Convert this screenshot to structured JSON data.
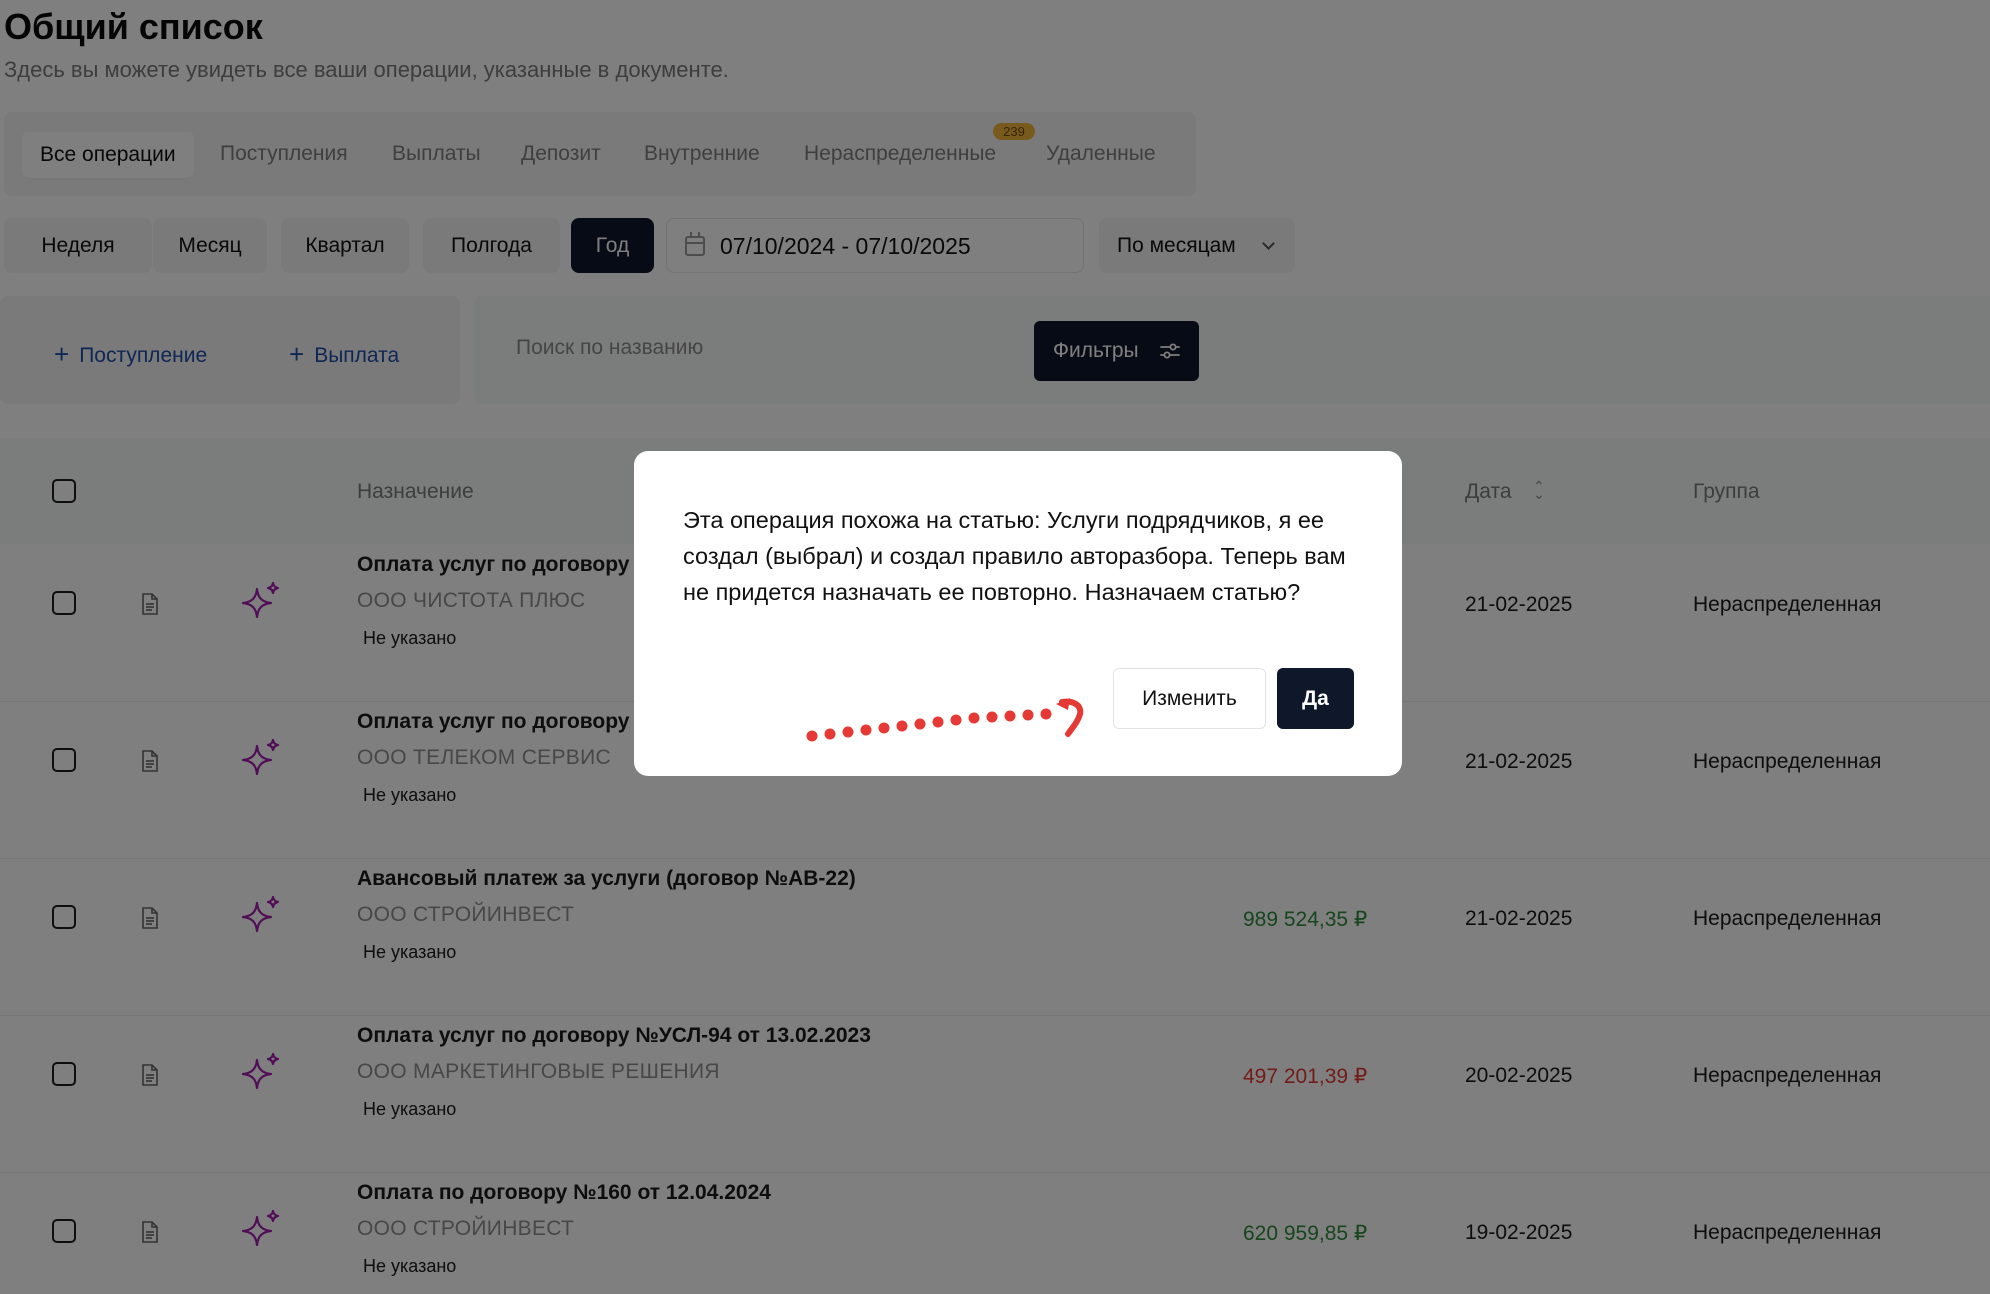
{
  "page": {
    "title": "Общий список",
    "subtitle": "Здесь вы можете увидеть все ваши операции, указанные в документе."
  },
  "tabs": [
    {
      "label": "Все операции",
      "active": true
    },
    {
      "label": "Поступления"
    },
    {
      "label": "Выплаты"
    },
    {
      "label": "Депозит"
    },
    {
      "label": "Внутренние"
    },
    {
      "label": "Нераспределенные",
      "badge": "239"
    },
    {
      "label": "Удаленные"
    }
  ],
  "periods": [
    {
      "label": "Неделя"
    },
    {
      "label": "Месяц"
    },
    {
      "label": "Квартал"
    },
    {
      "label": "Полгода"
    },
    {
      "label": "Год",
      "active": true
    }
  ],
  "date_range": "07/10/2024 - 07/10/2025",
  "grouping": "По месяцам",
  "actions": {
    "add_income": "Поступление",
    "add_payout": "Выплата",
    "search_placeholder": "Поиск по названию",
    "filters": "Фильтры"
  },
  "table": {
    "headers": {
      "purpose": "Назначение",
      "date": "Дата",
      "group": "Группа"
    },
    "rows": [
      {
        "title": "Оплата услуг по договору",
        "counterparty": "ООО ЧИСТОТА ПЛЮС",
        "note": "Не указано",
        "amount": "",
        "amount_color": "",
        "date": "21-02-2025",
        "group": "Нераспределенная"
      },
      {
        "title": "Оплата услуг по договору",
        "counterparty": "ООО ТЕЛЕКОМ СЕРВИС",
        "note": "Не указано",
        "amount": "",
        "amount_color": "",
        "date": "21-02-2025",
        "group": "Нераспределенная"
      },
      {
        "title": "Авансовый платеж за услуги (договор №АВ-22)",
        "counterparty": "ООО СТРОЙИНВЕСТ",
        "note": "Не указано",
        "amount": "989 524,35 ₽",
        "amount_color": "#2e8b3a",
        "date": "21-02-2025",
        "group": "Нераспределенная"
      },
      {
        "title": "Оплата услуг по договору №УСЛ-94 от 13.02.2023",
        "counterparty": "ООО МАРКЕТИНГОВЫЕ РЕШЕНИЯ",
        "note": "Не указано",
        "amount": "497 201,39 ₽",
        "amount_color": "#e53935",
        "date": "20-02-2025",
        "group": "Нераспределенная"
      },
      {
        "title": "Оплата по договору №160 от 12.04.2024",
        "counterparty": "ООО СТРОЙИНВЕСТ",
        "note": "Не указано",
        "amount": "620 959,85 ₽",
        "amount_color": "#2e8b3a",
        "date": "19-02-2025",
        "group": "Нераспределенная"
      }
    ]
  },
  "modal": {
    "text": "Эта операция похожа на статью: Услуги подрядчиков, я ее создал (выбрал) и создал правило авторазбора. Теперь вам не придется назначать ее повторно. Назначаем статью?",
    "change_label": "Изменить",
    "yes_label": "Да"
  },
  "colors": {
    "primary_dark": "#0f172a",
    "link_blue": "#1e4fa8",
    "income_green": "#2e8b3a",
    "expense_red": "#e53935",
    "ai_purple": "#a21caf",
    "badge_yellow": "#f2b53b",
    "hint_arrow_red": "#e53935"
  },
  "icons": {
    "calendar": "calendar-icon",
    "chevron": "chevron-down-icon",
    "plus": "plus-icon",
    "filters": "sliders-icon",
    "document": "document-icon",
    "ai": "sparkle-icon",
    "sort": "sort-icon",
    "hint": "curved-arrow-icon"
  }
}
